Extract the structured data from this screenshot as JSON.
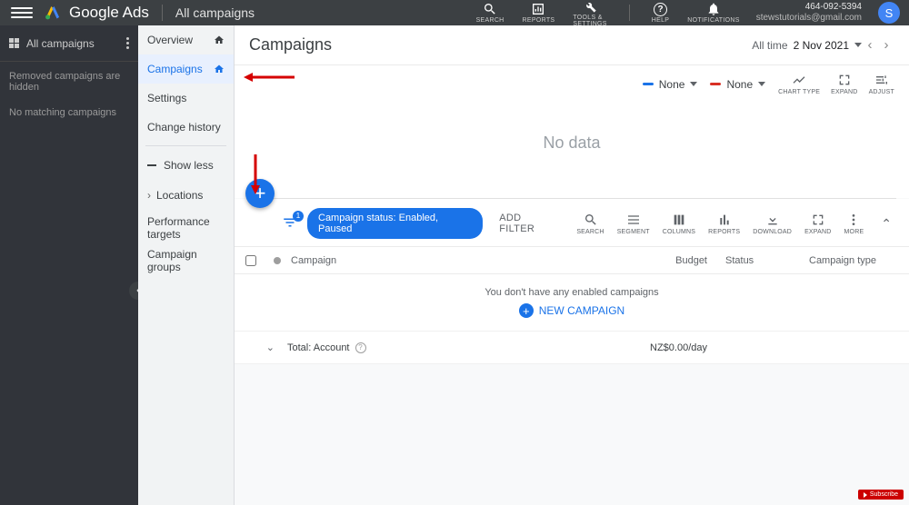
{
  "header": {
    "product": "Google Ads",
    "context": "All campaigns",
    "actions": {
      "search": "SEARCH",
      "reports": "REPORTS",
      "tools": "TOOLS &\nSETTINGS",
      "help": "HELP",
      "notifications": "NOTIFICATIONS"
    },
    "account": {
      "phone": "464-092-5394",
      "email": "stewstutorials@gmail.com",
      "avatar_initial": "S"
    }
  },
  "leftnav": {
    "label": "All campaigns",
    "msg1": "Removed campaigns are hidden",
    "msg2": "No matching campaigns"
  },
  "subnav": {
    "overview": "Overview",
    "campaigns": "Campaigns",
    "settings": "Settings",
    "change_history": "Change history",
    "show_less": "Show less",
    "locations": "Locations",
    "perf": "Performance targets",
    "groups": "Campaign groups"
  },
  "page": {
    "title": "Campaigns",
    "date_prefix": "All time",
    "date_value": "2 Nov 2021",
    "series_none": "None",
    "chart_type": "CHART TYPE",
    "expand": "EXPAND",
    "adjust": "ADJUST",
    "no_data": "No data"
  },
  "toolbar": {
    "filter_chip": "Campaign status: Enabled, Paused",
    "filter_badge": "1",
    "add_filter": "ADD FILTER",
    "icons": {
      "search": "SEARCH",
      "segment": "SEGMENT",
      "columns": "COLUMNS",
      "reports": "REPORTS",
      "download": "DOWNLOAD",
      "expand": "EXPAND",
      "more": "MORE"
    }
  },
  "table": {
    "col_campaign": "Campaign",
    "col_budget": "Budget",
    "col_status": "Status",
    "col_type": "Campaign type",
    "empty_msg": "You don't have any enabled campaigns",
    "new_campaign": "NEW CAMPAIGN",
    "total_label": "Total: Account",
    "total_budget": "NZ$0.00/day"
  },
  "subscribe": "Subscribe"
}
